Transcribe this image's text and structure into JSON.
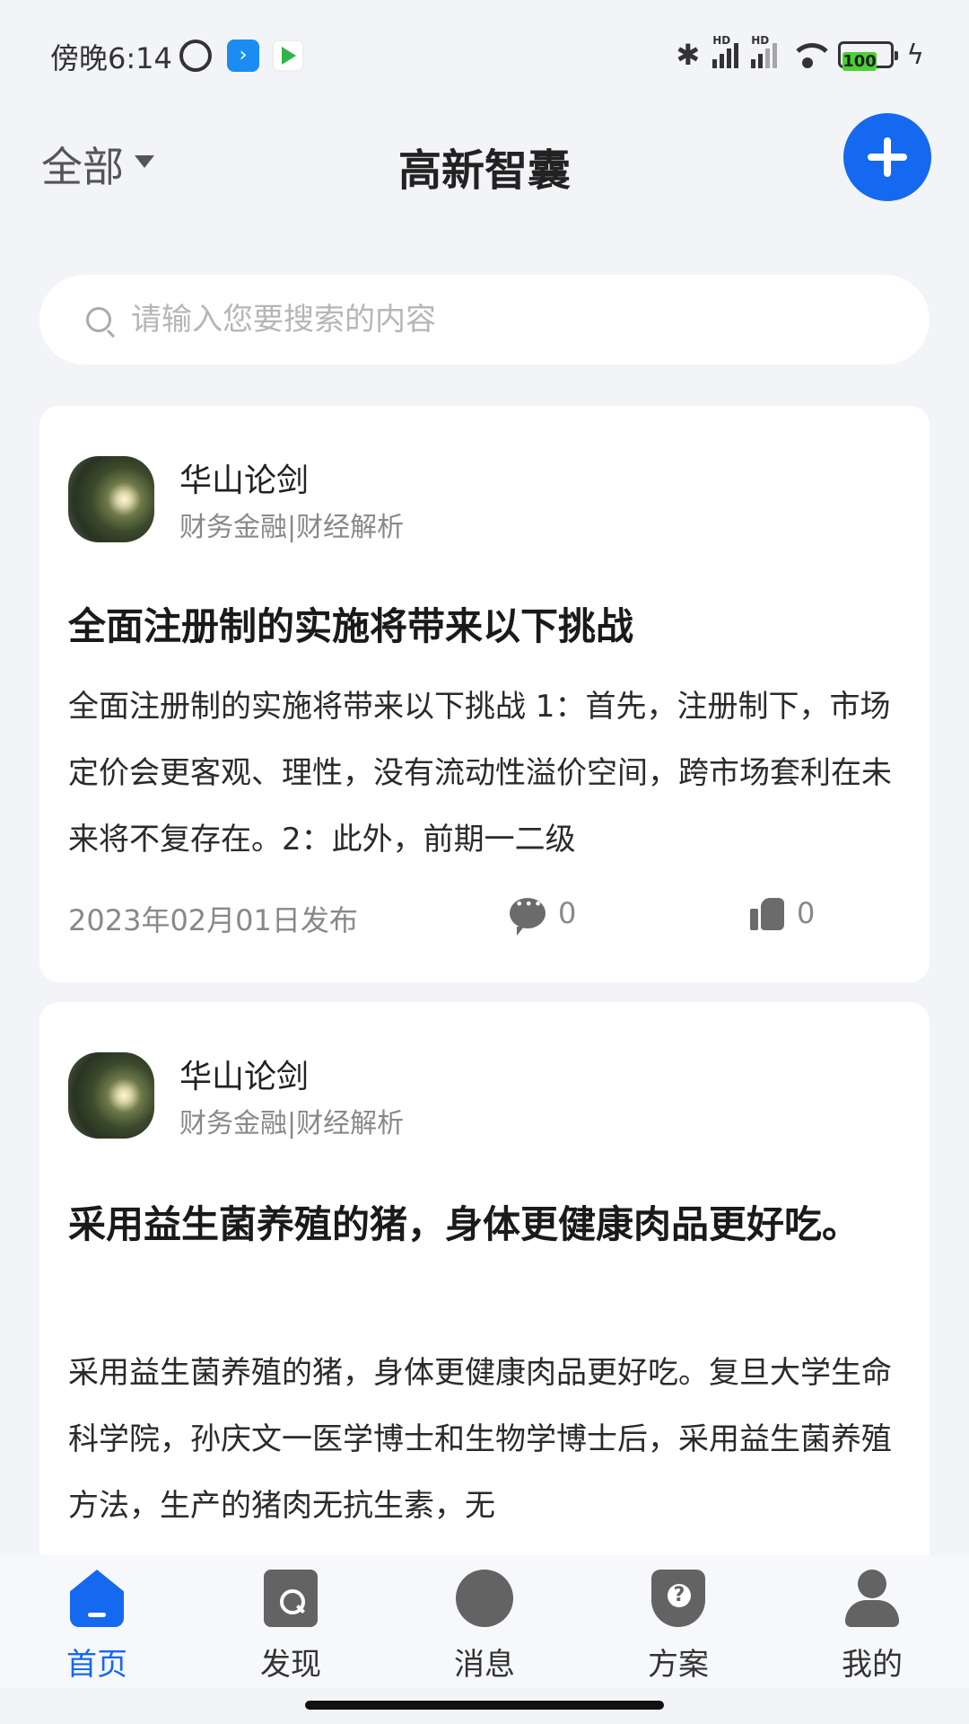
{
  "status_bar": {
    "time": "傍晚6:14",
    "battery": "100"
  },
  "header": {
    "filter_label": "全部",
    "title": "高新智囊"
  },
  "search": {
    "placeholder": "请输入您要搜索的内容"
  },
  "posts": [
    {
      "author": "华山论剑",
      "category": "财务金融|财经解析",
      "title": "全面注册制的实施将带来以下挑战",
      "body": "全面注册制的实施将带来以下挑战 1：首先，注册制下，市场定价会更客观、理性，没有流动性溢价空间，跨市场套利在未来将不复存在。2：此外，前期一二级",
      "date": "2023年02月01日发布",
      "comments": "0",
      "likes": "0"
    },
    {
      "author": "华山论剑",
      "category": "财务金融|财经解析",
      "title": "采用益生菌养殖的猪，身体更健康肉品更好吃。",
      "body": "采用益生菌养殖的猪，身体更健康肉品更好吃。复旦大学生命科学院，孙庆文一医学博士和生物学博士后，采用益生菌养殖方法，生产的猪肉无抗生素，无"
    }
  ],
  "bottom_nav": [
    {
      "label": "首页",
      "icon": "home-icon",
      "active": true
    },
    {
      "label": "发现",
      "icon": "discover-icon",
      "active": false
    },
    {
      "label": "消息",
      "icon": "message-icon",
      "active": false
    },
    {
      "label": "方案",
      "icon": "plan-icon",
      "active": false
    },
    {
      "label": "我的",
      "icon": "profile-icon",
      "active": false
    }
  ],
  "colors": {
    "accent": "#1469f0",
    "background": "#f3f4f8",
    "card": "#ffffff"
  }
}
